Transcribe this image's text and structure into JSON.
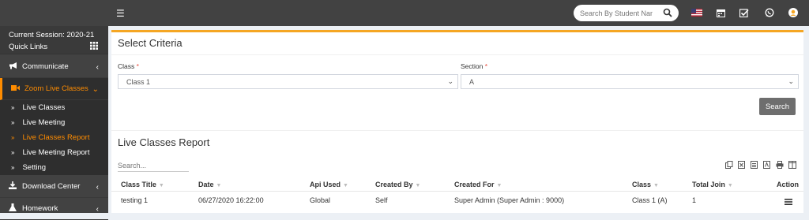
{
  "topbar": {
    "search_placeholder": "Search By Student Name",
    "icons": [
      "menu-icon",
      "search-icon",
      "us-flag-icon",
      "calendar-icon",
      "task-check-icon",
      "whatsapp-icon",
      "user-avatar-icon"
    ]
  },
  "sidebar": {
    "session": "Current Session: 2020-21",
    "quick_links": "Quick Links",
    "items": [
      {
        "label": "Communicate",
        "icon": "megaphone-icon"
      },
      {
        "label": "Zoom Live Classes",
        "icon": "video-camera-icon",
        "active": true
      },
      {
        "label": "Download Center",
        "icon": "download-icon"
      },
      {
        "label": "Homework",
        "icon": "flask-icon"
      }
    ],
    "subitems": [
      "Live Classes",
      "Live Meeting",
      "Live Classes Report",
      "Live Meeting Report",
      "Setting"
    ],
    "current_subitem": "Live Classes Report"
  },
  "criteria": {
    "title": "Select Criteria",
    "class_label": "Class",
    "class_value": "Class 1",
    "section_label": "Section",
    "section_value": "A",
    "search_button": "Search"
  },
  "report": {
    "title": "Live Classes Report",
    "search_placeholder": "Search...",
    "export_icons": [
      "copy-icon",
      "excel-icon",
      "csv-icon",
      "pdf-icon",
      "print-icon",
      "columns-icon"
    ],
    "columns": [
      "Class Title",
      "Date",
      "Api Used",
      "Created By",
      "Created For",
      "Class",
      "Total Join",
      "Action"
    ],
    "rows": [
      {
        "title": "testing 1",
        "date": "06/27/2020 16:22:00",
        "api": "Global",
        "created_by": "Self",
        "created_for": "Super Admin (Super Admin : 9000)",
        "class": "Class 1 (A)",
        "total_join": "1"
      }
    ]
  },
  "colors": {
    "accent": "#ff8c00",
    "topbar": "#424242",
    "panel_border": "#f5a623"
  }
}
